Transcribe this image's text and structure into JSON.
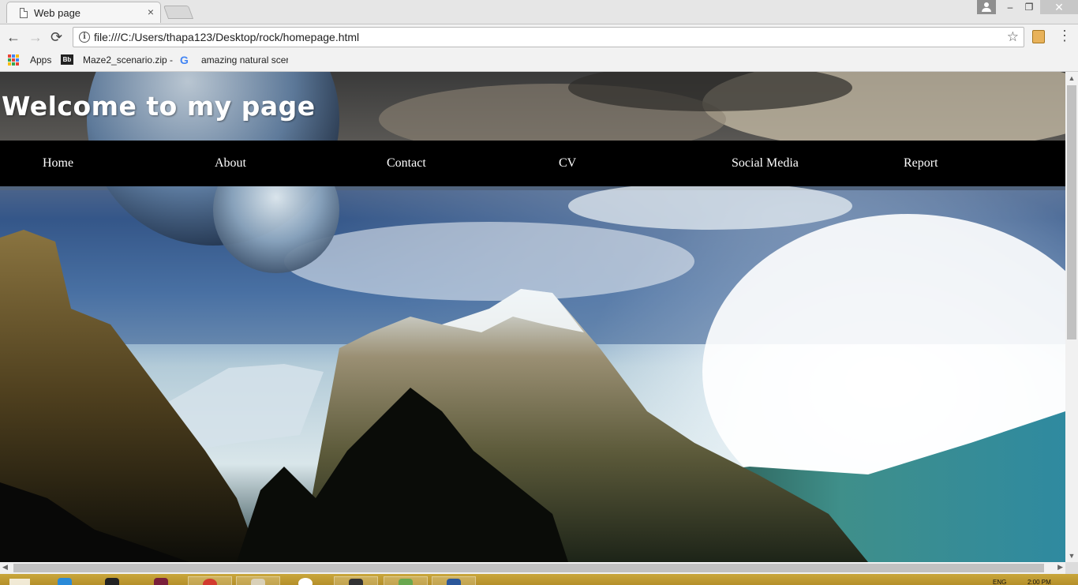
{
  "browser": {
    "tab_title": "Web page",
    "tab_close": "×",
    "url": "file:///C:/Users/thapa123/Desktop/rock/homepage.html",
    "window_controls": {
      "minimize": "–",
      "maximize": "❐",
      "close": "✕"
    },
    "nav": {
      "back": "←",
      "forward": "→",
      "reload": "⟳",
      "star": "☆",
      "menu": "⋮",
      "info": "i"
    },
    "bookmarks": [
      {
        "label": "Apps",
        "icon": "apps-grid-icon"
      },
      {
        "label": "Maze2_scenario.zip -",
        "icon": "blackboard-icon"
      },
      {
        "label": "amazing natural scer",
        "icon": "google-icon"
      }
    ],
    "bb_icon_text": "Bb",
    "google_icon_text": "G"
  },
  "page": {
    "heading": "Welcome to my page",
    "nav_links": [
      "Home",
      "About",
      "Contact",
      "CV",
      "Social Media",
      "Report"
    ],
    "background": "mountain landscape with planets"
  },
  "taskbar": {
    "language": "ENG",
    "time": "2:00 PM"
  },
  "colors": {
    "nav_bar": "#000000",
    "heading_text": "#ffffff",
    "taskbar": "#c9a73c"
  }
}
